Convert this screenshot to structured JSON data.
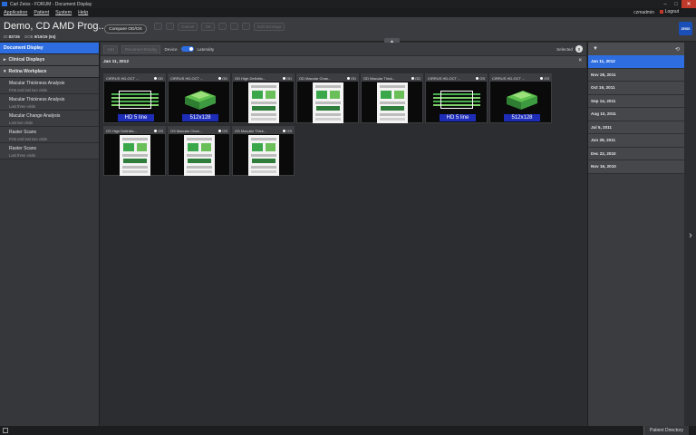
{
  "window": {
    "title": "Carl Zeiss - FORUM - Document Display"
  },
  "menu": {
    "items": [
      "Application",
      "Patient",
      "System",
      "Help"
    ],
    "user": "czmadmin",
    "logout": "Logout"
  },
  "patient": {
    "name": "Demo, CD AMD Prog...",
    "id_label": "ID",
    "id_value": "82726",
    "dob_label": "DOB",
    "dob_value": "9/15/19 (94)"
  },
  "header": {
    "compare_label": "Compare OD/OS",
    "toolbar": [
      "Cancel",
      "OK",
      "Edit Sizzings"
    ],
    "logo_text": "ZEISS"
  },
  "sidebar": {
    "document_display": "Document Display",
    "clinical_displays": "Clinical Displays",
    "retina_workplace": "Retina Workplace",
    "items": [
      {
        "title": "Macular Thickness Analysis",
        "sub": "First and last two visits"
      },
      {
        "title": "Macular Thickness Analysis",
        "sub": "Last three visits"
      },
      {
        "title": "Macular Change Analysis",
        "sub": "Last two visits"
      },
      {
        "title": "Raster Scans",
        "sub": "First and last two visits"
      },
      {
        "title": "Raster Scans",
        "sub": "Last three visits"
      }
    ]
  },
  "filters": {
    "add": "Add",
    "documents": "Document Display",
    "device_label": "Device",
    "laterality_label": "Laterality",
    "selected_label": "Selected",
    "selected_count": "0"
  },
  "group": {
    "date": "Jan 11, 2012"
  },
  "thumbnails": [
    {
      "title": "CIRRUS HD-OCT ...",
      "eye": "OD",
      "kind": "oct",
      "label": "HD 5 line"
    },
    {
      "title": "CIRRUS HD-OCT ...",
      "eye": "OD",
      "kind": "cube",
      "label": "512x128"
    },
    {
      "title": "OD High Definitio...",
      "eye": "OD",
      "kind": "doc"
    },
    {
      "title": "OD Macular Chan...",
      "eye": "OD",
      "kind": "doc"
    },
    {
      "title": "OD Macular Thick...",
      "eye": "OD",
      "kind": "doc"
    },
    {
      "title": "CIRRUS HD-OCT ...",
      "eye": "OS",
      "kind": "oct",
      "label": "HD 5 line"
    },
    {
      "title": "CIRRUS HD-OCT ...",
      "eye": "OS",
      "kind": "cube",
      "label": "512x128"
    },
    {
      "title": "OS High Definitio...",
      "eye": "OS",
      "kind": "doc"
    },
    {
      "title": "OS Macular Chan...",
      "eye": "OS",
      "kind": "doc"
    },
    {
      "title": "OS Macular Thick...",
      "eye": "OS",
      "kind": "doc"
    }
  ],
  "visits": [
    {
      "date": "Jan 11, 2012",
      "active": true
    },
    {
      "date": "Nov 28, 2011"
    },
    {
      "date": "Oct 19, 2011"
    },
    {
      "date": "Sep 14, 2011"
    },
    {
      "date": "Aug 10, 2011"
    },
    {
      "date": "Jul 5, 2011"
    },
    {
      "date": "Jun 28, 2011"
    },
    {
      "date": "Dec 22, 2010"
    },
    {
      "date": "Nov 16, 2010"
    }
  ],
  "status": {
    "patient_directory": "Patient Directory"
  },
  "colors": {
    "accent": "#2d6de0",
    "label_blue": "#1d2db8",
    "green": "#47b04c"
  }
}
